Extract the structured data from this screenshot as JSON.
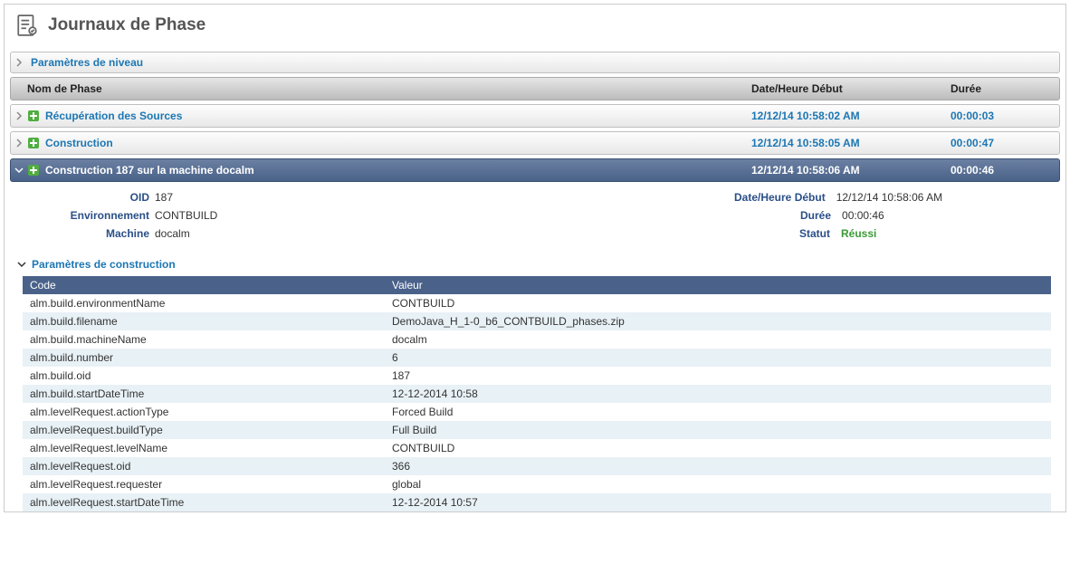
{
  "title": "Journaux de Phase",
  "level_params": "Paramètres de niveau",
  "columns": {
    "name": "Nom de Phase",
    "date": "Date/Heure Début",
    "dur": "Durée"
  },
  "phases": [
    {
      "name": "Récupération des Sources",
      "date": "12/12/14 10:58:02 AM",
      "dur": "00:00:03"
    },
    {
      "name": "Construction",
      "date": "12/12/14 10:58:05 AM",
      "dur": "00:00:47"
    }
  ],
  "expanded": {
    "name": "Construction 187 sur la machine docalm",
    "date": "12/12/14 10:58:06 AM",
    "dur": "00:00:46"
  },
  "details": {
    "oid_label": "OID",
    "oid": "187",
    "env_label": "Environnement",
    "env": "CONTBUILD",
    "machine_label": "Machine",
    "machine": "docalm",
    "start_label": "Date/Heure Début",
    "start": "12/12/14 10:58:06 AM",
    "dur_label": "Durée",
    "dur": "00:00:46",
    "status_label": "Statut",
    "status": "Réussi"
  },
  "build_params_label": "Paramètres de construction",
  "param_cols": {
    "code": "Code",
    "val": "Valeur"
  },
  "params": [
    {
      "code": "alm.build.environmentName",
      "val": "CONTBUILD"
    },
    {
      "code": "alm.build.filename",
      "val": "DemoJava_H_1-0_b6_CONTBUILD_phases.zip"
    },
    {
      "code": "alm.build.machineName",
      "val": "docalm"
    },
    {
      "code": "alm.build.number",
      "val": "6"
    },
    {
      "code": "alm.build.oid",
      "val": "187"
    },
    {
      "code": "alm.build.startDateTime",
      "val": "12-12-2014 10:58"
    },
    {
      "code": "alm.levelRequest.actionType",
      "val": "Forced Build"
    },
    {
      "code": "alm.levelRequest.buildType",
      "val": "Full Build"
    },
    {
      "code": "alm.levelRequest.levelName",
      "val": "CONTBUILD"
    },
    {
      "code": "alm.levelRequest.oid",
      "val": "366"
    },
    {
      "code": "alm.levelRequest.requester",
      "val": "global"
    },
    {
      "code": "alm.levelRequest.startDateTime",
      "val": "12-12-2014 10:57"
    }
  ]
}
